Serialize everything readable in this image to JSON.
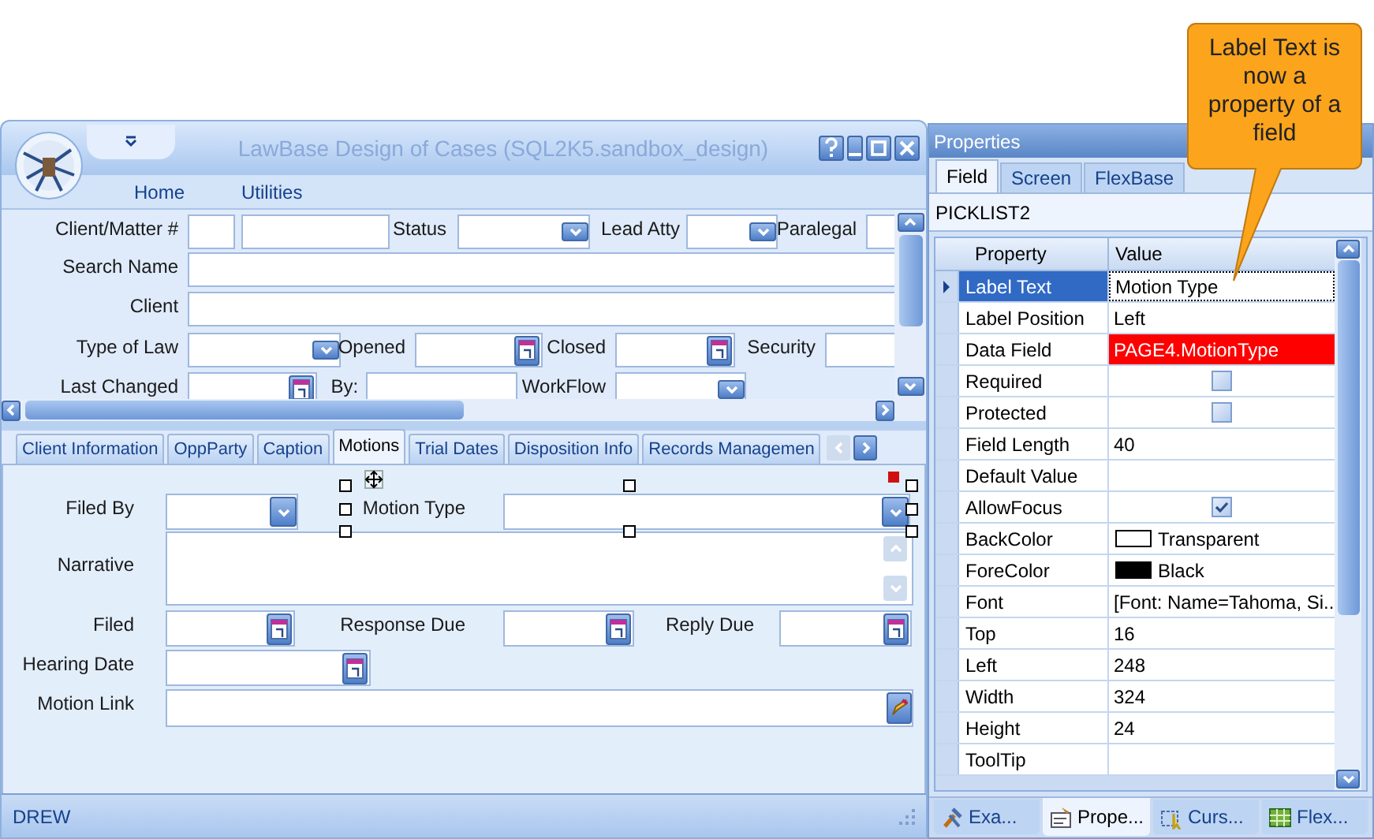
{
  "callout": {
    "text": "Label Text is now a property of a field"
  },
  "window": {
    "title": "LawBase Design of Cases (SQL2K5.sandbox_design)",
    "menu": [
      "Home",
      "Utilities"
    ],
    "header_fields": [
      {
        "label": "Client/Matter #",
        "kind": "text"
      },
      {
        "kind": "text"
      },
      {
        "label": "Status",
        "kind": "dropdown"
      },
      {
        "label": "Lead Atty",
        "kind": "dropdown"
      },
      {
        "label": "Paralegal",
        "kind": "text"
      },
      {
        "label": "Search Name",
        "kind": "text"
      },
      {
        "label": "Client",
        "kind": "text"
      },
      {
        "label": "Type of Law",
        "kind": "dropdown"
      },
      {
        "label": "Opened",
        "kind": "date"
      },
      {
        "label": "Closed",
        "kind": "date"
      },
      {
        "label": "Security",
        "kind": "text"
      },
      {
        "label": "Last Changed",
        "kind": "date"
      },
      {
        "label": "By:",
        "kind": "text"
      },
      {
        "label": "WorkFlow",
        "kind": "dropdown"
      }
    ],
    "tabs": [
      {
        "label": "Client Information",
        "selected": false
      },
      {
        "label": "OppParty",
        "selected": false
      },
      {
        "label": "Caption",
        "selected": false
      },
      {
        "label": "Motions",
        "selected": true
      },
      {
        "label": "Trial Dates",
        "selected": false
      },
      {
        "label": "Disposition Info",
        "selected": false
      },
      {
        "label": "Records Managemen",
        "selected": false
      }
    ],
    "tab_fields": [
      {
        "label": "Filed By",
        "kind": "dropdown",
        "selected": false
      },
      {
        "label": "Motion Type",
        "kind": "dropdown",
        "selected": true
      },
      {
        "label": "Narrative",
        "kind": "memo",
        "selected": false
      },
      {
        "label": "Filed",
        "kind": "date",
        "selected": false
      },
      {
        "label": "Response Due",
        "kind": "date",
        "selected": false
      },
      {
        "label": "Reply Due",
        "kind": "date",
        "selected": false
      },
      {
        "label": "Hearing Date",
        "kind": "date",
        "selected": false
      },
      {
        "label": "Motion Link",
        "kind": "link",
        "selected": false
      }
    ],
    "status_bar": "DREW"
  },
  "properties": {
    "title": "Properties",
    "tabs": [
      {
        "label": "Field",
        "selected": true
      },
      {
        "label": "Screen",
        "selected": false
      },
      {
        "label": "FlexBase",
        "selected": false
      }
    ],
    "object_name": "PICKLIST2",
    "columns": [
      "Property",
      "Value"
    ],
    "rows": [
      {
        "property": "Label Text",
        "kind": "text",
        "value": "Motion Type",
        "selected": true,
        "highlighted": false
      },
      {
        "property": "Label Position",
        "kind": "text",
        "value": "Left",
        "selected": false,
        "highlighted": false
      },
      {
        "property": "Data Field",
        "kind": "text",
        "value": "PAGE4.MotionType",
        "selected": false,
        "highlighted": true
      },
      {
        "property": "Required",
        "kind": "checkbox",
        "checked": false,
        "selected": false,
        "highlighted": false
      },
      {
        "property": "Protected",
        "kind": "checkbox",
        "checked": false,
        "selected": false,
        "highlighted": false
      },
      {
        "property": "Field Length",
        "kind": "text",
        "value": "40",
        "selected": false,
        "highlighted": false
      },
      {
        "property": "Default Value",
        "kind": "text",
        "selected": false,
        "highlighted": false
      },
      {
        "property": "AllowFocus",
        "kind": "checkbox",
        "checked": true,
        "selected": false,
        "highlighted": false
      },
      {
        "property": "BackColor",
        "kind": "color",
        "color": "#ffffff",
        "value": "Transparent",
        "selected": false,
        "highlighted": false
      },
      {
        "property": "ForeColor",
        "kind": "color",
        "color": "#000000",
        "value": "Black",
        "selected": false,
        "highlighted": false
      },
      {
        "property": "Font",
        "kind": "text",
        "value": "[Font: Name=Tahoma, Si...",
        "selected": false,
        "highlighted": false
      },
      {
        "property": "Top",
        "kind": "text",
        "value": "16",
        "selected": false,
        "highlighted": false
      },
      {
        "property": "Left",
        "kind": "text",
        "value": "248",
        "selected": false,
        "highlighted": false
      },
      {
        "property": "Width",
        "kind": "text",
        "value": "324",
        "selected": false,
        "highlighted": false
      },
      {
        "property": "Height",
        "kind": "text",
        "value": "24",
        "selected": false,
        "highlighted": false
      },
      {
        "property": "ToolTip",
        "kind": "text",
        "selected": false,
        "highlighted": false
      }
    ],
    "bottom_tabs": [
      {
        "label": "Exa...",
        "selected": false
      },
      {
        "label": "Prope...",
        "selected": true
      },
      {
        "label": "Curs...",
        "selected": false
      },
      {
        "label": "Flex...",
        "selected": false
      }
    ]
  }
}
